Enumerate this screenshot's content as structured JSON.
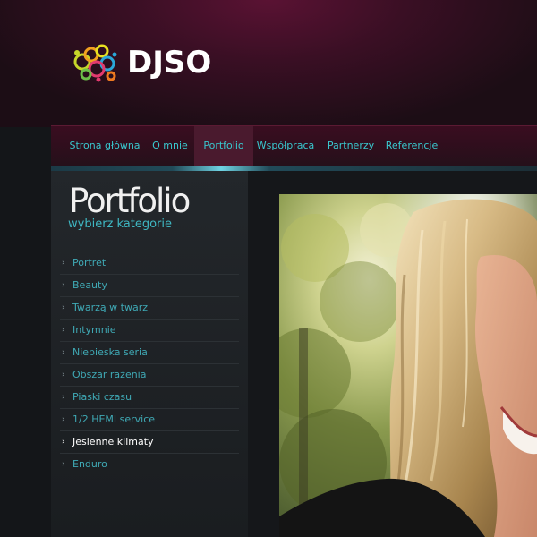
{
  "brand": {
    "name": "DJSO"
  },
  "nav": {
    "items": [
      {
        "label": "Strona główna"
      },
      {
        "label": "O mnie"
      },
      {
        "label": "Portfolio"
      },
      {
        "label": "Współpraca"
      },
      {
        "label": "Partnerzy"
      },
      {
        "label": "Referencje"
      }
    ],
    "active": "Portfolio"
  },
  "sidebar": {
    "title": "Portfolio",
    "subtitle": "wybierz kategorie",
    "categories": [
      {
        "label": "Portret"
      },
      {
        "label": "Beauty"
      },
      {
        "label": "Twarzą w twarz"
      },
      {
        "label": "Intymnie"
      },
      {
        "label": "Niebieska seria"
      },
      {
        "label": "Obszar rażenia"
      },
      {
        "label": "Piaski czasu"
      },
      {
        "label": "1/2 HEMI service"
      },
      {
        "label": "Jesienne klimaty"
      },
      {
        "label": "Enduro"
      }
    ],
    "active_category": "Jesienne klimaty",
    "bullet": "›"
  },
  "colors": {
    "accent": "#39c8cf",
    "header_bg": "#3a0f24",
    "sidebar_bg": "#23272b",
    "active_text": "#ffffff"
  },
  "icons": {
    "logo": "colorful-rings-logo-icon",
    "bullet": "chevron-right-icon"
  }
}
